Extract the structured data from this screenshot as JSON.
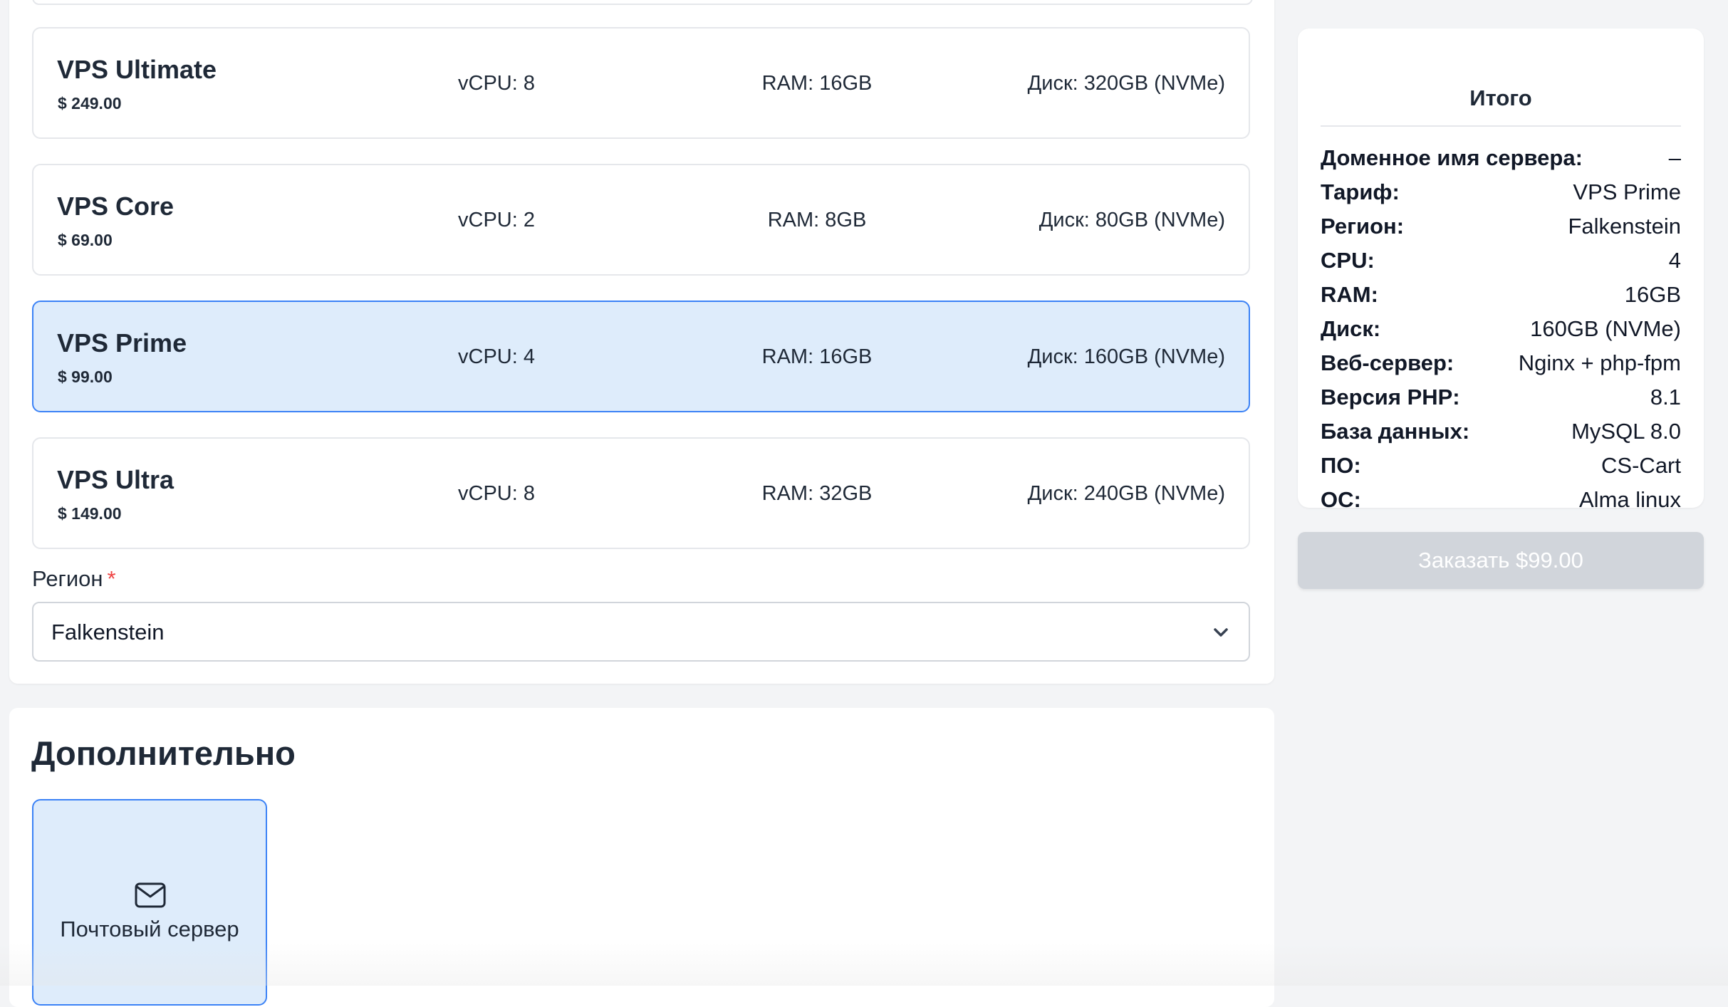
{
  "plans": [
    {
      "name": "VPS Ultimate",
      "price": "$ 249.00",
      "cpu": "vCPU: 8",
      "ram": "RAM: 16GB",
      "disk": "Диск: 320GB (NVMe)"
    },
    {
      "name": "VPS Core",
      "price": "$ 69.00",
      "cpu": "vCPU: 2",
      "ram": "RAM: 8GB",
      "disk": "Диск: 80GB (NVMe)"
    },
    {
      "name": "VPS Prime",
      "price": "$ 99.00",
      "cpu": "vCPU: 4",
      "ram": "RAM: 16GB",
      "disk": "Диск: 160GB (NVMe)",
      "selected": true
    },
    {
      "name": "VPS Ultra",
      "price": "$ 149.00",
      "cpu": "vCPU: 8",
      "ram": "RAM: 32GB",
      "disk": "Диск: 240GB (NVMe)"
    }
  ],
  "region": {
    "label": "Регион",
    "required_mark": "*",
    "value": "Falkenstein"
  },
  "extra": {
    "title": "Дополнительно",
    "addon_label": "Почтовый сервер",
    "addon_icon": "mail-icon"
  },
  "summary": {
    "title": "Итого",
    "rows": [
      {
        "key": "Доменное имя сервера:",
        "value": "–"
      },
      {
        "key": "Тариф:",
        "value": "VPS Prime"
      },
      {
        "key": "Регион:",
        "value": "Falkenstein"
      },
      {
        "key": "CPU:",
        "value": "4"
      },
      {
        "key": "RAM:",
        "value": "16GB"
      },
      {
        "key": "Диск:",
        "value": "160GB (NVMe)"
      },
      {
        "key": "Веб-сервер:",
        "value": "Nginx + php-fpm"
      },
      {
        "key": "Версия PHP:",
        "value": "8.1"
      },
      {
        "key": "База данных:",
        "value": "MySQL 8.0"
      },
      {
        "key": "ПО:",
        "value": "CS-Cart"
      },
      {
        "key": "ОС:",
        "value": "Alma linux"
      }
    ]
  },
  "order_button": {
    "label": "Заказать $99.00",
    "disabled": true
  },
  "colors": {
    "accent": "#3b82f6",
    "selected_bg": "#deecfb",
    "required": "#ef4444",
    "disabled_btn": "#d1d5db"
  }
}
